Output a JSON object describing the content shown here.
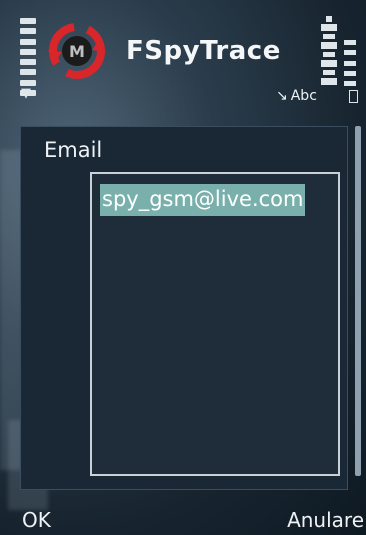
{
  "app": {
    "title": "FSpyTrace",
    "icon": "fspytrace-app-icon"
  },
  "status": {
    "input_mode": "Abc",
    "input_mode_icon": "pen-input-icon",
    "signal_icon": "signal-strength-icon",
    "battery_icon": "battery-icon"
  },
  "form": {
    "field_label": "Email",
    "field_value": "spy_gsm@live.com"
  },
  "softkeys": {
    "left": "OK",
    "right": "Anulare"
  },
  "colors": {
    "selection": "#79b0ac",
    "panel": "#1a2836",
    "text": "#eef2f5"
  }
}
